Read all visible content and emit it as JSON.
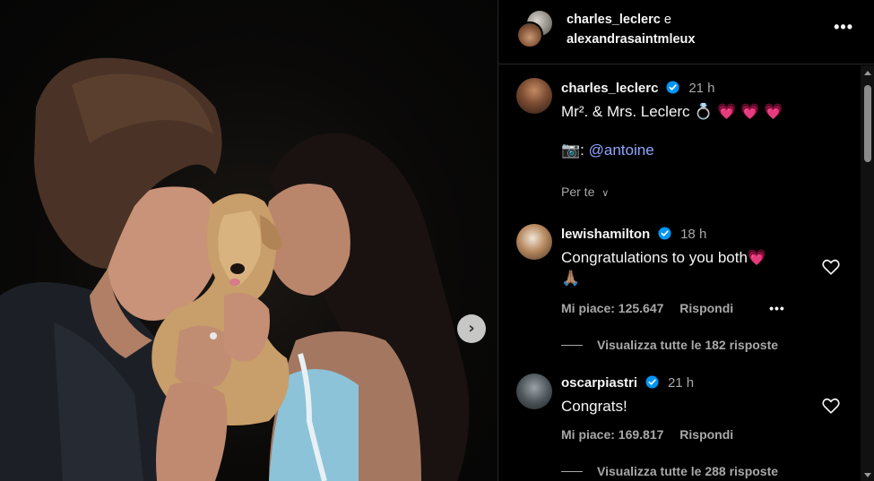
{
  "header": {
    "user1": "charles_leclerc",
    "conjunction": "e",
    "user2": "alexandrasaintmleux",
    "more_icon": "more-horizontal-icon"
  },
  "post": {
    "username": "charles_leclerc",
    "time": "21 h",
    "caption_text": "Mr². & Mrs. Leclerc",
    "caption_emojis": "💍 💗 💗 💗",
    "credit_prefix": "📷:",
    "credit_mention": "@antoine",
    "translate_label": "Per te"
  },
  "comments": [
    {
      "username": "lewishamilton",
      "time": "18 h",
      "text": "Congratulations to you both",
      "emoji": "💗",
      "emoji_line2": "🙏🏽",
      "likes_label": "Mi piace: 125.647",
      "reply_label": "Rispondi",
      "replies_label": "Visualizza tutte le 182 risposte"
    },
    {
      "username": "oscarpiastri",
      "time": "21 h",
      "text": "Congrats!",
      "likes_label": "Mi piace: 169.817",
      "reply_label": "Rispondi",
      "replies_label": "Visualizza tutte le 288 risposte"
    }
  ],
  "carousel": {
    "next_icon": "chevron-right-icon"
  },
  "colors": {
    "background": "#000000",
    "verified": "#0095f6",
    "mention": "#8fa6ff",
    "muted": "#a8a8a8"
  }
}
